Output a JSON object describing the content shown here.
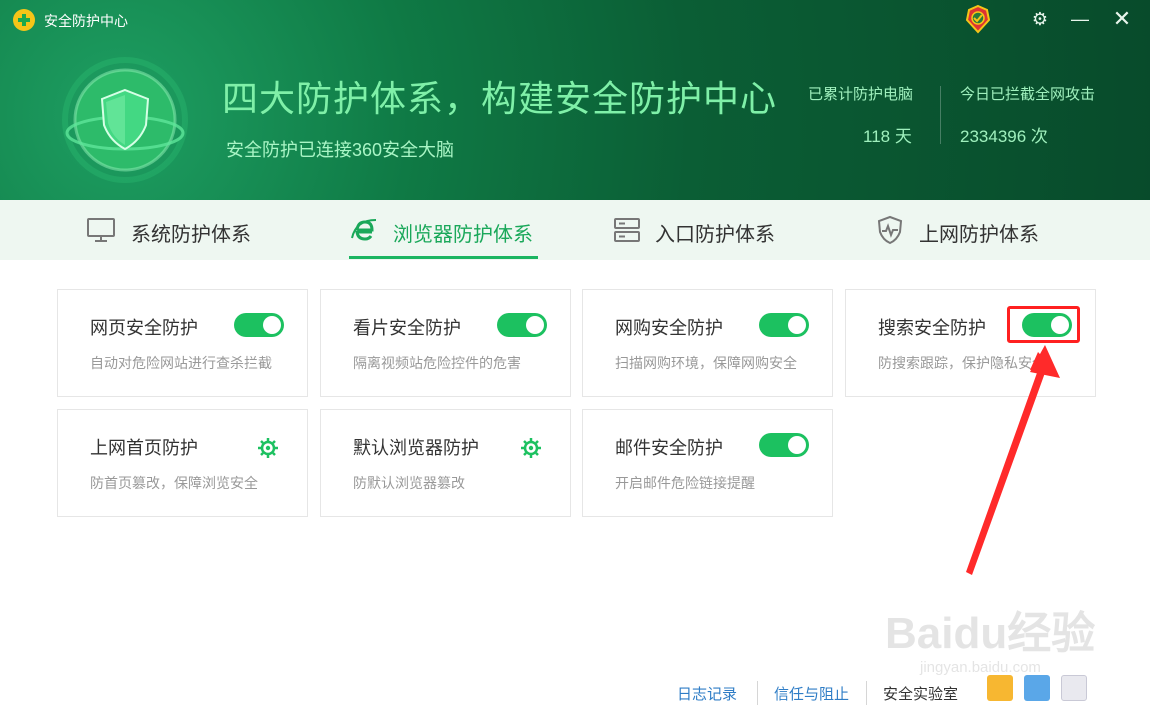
{
  "window": {
    "title": "安全防护中心"
  },
  "header": {
    "headline": "四大防护体系，构建安全防护中心",
    "subline": "安全防护已连接360安全大脑",
    "stats": [
      {
        "label": "已累计防护电脑",
        "value": "118 天"
      },
      {
        "label": "今日已拦截全网攻击",
        "value": "2334396 次"
      }
    ]
  },
  "tabs": [
    {
      "label": "系统防护体系",
      "icon": "monitor-icon",
      "active": false
    },
    {
      "label": "浏览器防护体系",
      "icon": "browser-e-icon",
      "active": true
    },
    {
      "label": "入口防护体系",
      "icon": "server-icon",
      "active": false
    },
    {
      "label": "上网防护体系",
      "icon": "shield-pulse-icon",
      "active": false
    }
  ],
  "cards": [
    {
      "title": "网页安全防护",
      "desc": "自动对危险网站进行查杀拦截",
      "control": "toggle",
      "on": true
    },
    {
      "title": "看片安全防护",
      "desc": "隔离视频站危险控件的危害",
      "control": "toggle",
      "on": true
    },
    {
      "title": "网购安全防护",
      "desc": "扫描网购环境，保障网购安全",
      "control": "toggle",
      "on": true
    },
    {
      "title": "搜索安全防护",
      "desc": "防搜索跟踪，保护隐私安全",
      "control": "toggle",
      "on": true
    },
    {
      "title": "上网首页防护",
      "desc": "防首页篡改，保障浏览安全",
      "control": "gear-icon"
    },
    {
      "title": "默认浏览器防护",
      "desc": "防默认浏览器篡改",
      "control": "gear-icon"
    },
    {
      "title": "邮件安全防护",
      "desc": "开启邮件危险链接提醒",
      "control": "toggle",
      "on": true
    }
  ],
  "footer": {
    "links": [
      "日志记录",
      "信任与阻止"
    ],
    "lab_label": "安全实验室"
  },
  "watermark": {
    "text": "Baidu经验",
    "sub": "jingyan.baidu.com"
  },
  "colors": {
    "accent": "#1cc160",
    "header_bg": "#0b5e35",
    "link": "#2f7dc6",
    "annotation": "#ff2020"
  }
}
